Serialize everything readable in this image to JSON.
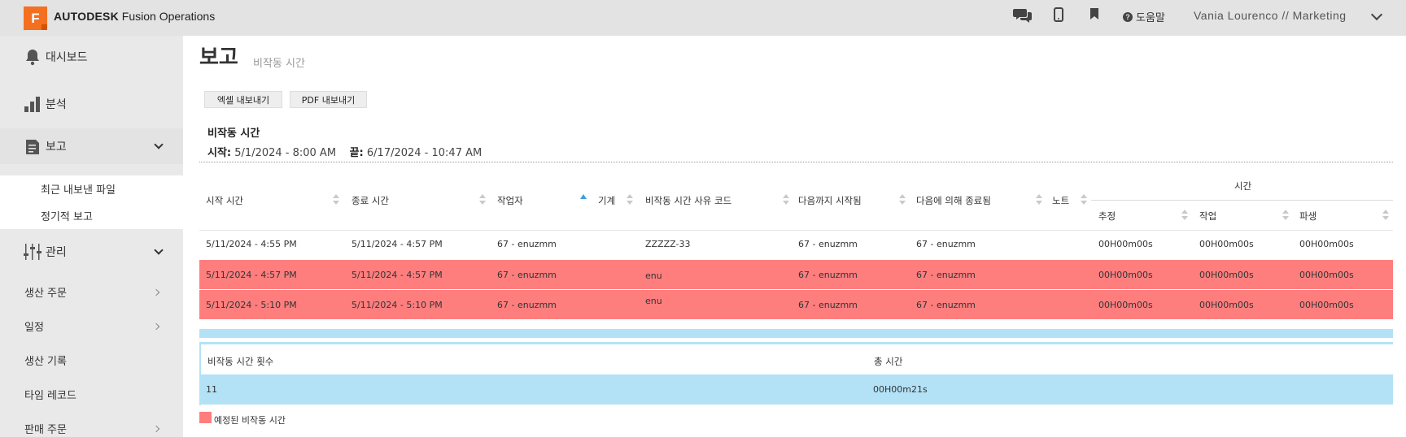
{
  "header": {
    "logo_letter": "F",
    "brand_bold": "AUTODESK",
    "brand_product": "Fusion Operations",
    "help_label": "도움말",
    "user": "Vania Lourenco // Marketing",
    "icons": [
      "chat-icon",
      "mobile-icon",
      "bookmark-icon",
      "help-icon",
      "chevron-down-icon"
    ]
  },
  "sidebar": {
    "dashboard": "대시보드",
    "analytics": "분석",
    "reports": "보고",
    "reports_sub": [
      "최근 내보낸 파일",
      "정기적 보고"
    ],
    "management": "관리",
    "management_sub": [
      "생산 주문",
      "일정",
      "생산 기록",
      "타임 레코드",
      "판매 주문"
    ]
  },
  "page": {
    "title": "보고",
    "subtitle": "비작동 시간",
    "export_excel": "엑셀 내보내기",
    "export_pdf": "PDF 내보내기",
    "report_title": "비작동 시간",
    "start_label": "시작:",
    "start_value": "5/1/2024 - 8:00 AM",
    "end_label": "끝:",
    "end_value": "6/17/2024 - 10:47 AM"
  },
  "table": {
    "headers": {
      "start": "시작 시간",
      "end": "종료 시간",
      "worker": "작업자",
      "machine": "기계",
      "reason": "비작동 시간 사유 코드",
      "started_by": "다음까지 시작됨",
      "ended_by": "다음에 의해 종료됨",
      "note": "노트",
      "time": "시간",
      "estimate": "추정",
      "work": "작업",
      "derived": "파생"
    },
    "rows": [
      {
        "start": "5/11/2024 - 4:55 PM",
        "end": "5/11/2024 - 4:57 PM",
        "worker": "67 - enuzmm",
        "machine": "",
        "reason": "ZZZZZ-33",
        "started_by": "67 - enuzmm",
        "ended_by": "67 - enuzmm",
        "note": "",
        "estimate": "00H00m00s",
        "work": "00H00m00s",
        "derived": "00H00m00s",
        "planned": false
      },
      {
        "start": "5/11/2024 - 4:57 PM",
        "end": "5/11/2024 - 4:57 PM",
        "worker": "67 - enuzmm",
        "machine": "",
        "reason": "enu",
        "started_by": "67 - enuzmm",
        "ended_by": "67 - enuzmm",
        "note": "",
        "estimate": "00H00m00s",
        "work": "00H00m00s",
        "derived": "00H00m00s",
        "planned": true
      },
      {
        "start": "5/11/2024 - 5:10 PM",
        "end": "5/11/2024 - 5:10 PM",
        "worker": "67 - enuzmm",
        "machine": "",
        "reason": "enu",
        "started_by": "67 - enuzmm",
        "ended_by": "67 - enuzmm",
        "note": "",
        "estimate": "00H00m00s",
        "work": "00H00m00s",
        "derived": "00H00m00s",
        "planned": true
      }
    ]
  },
  "summary": {
    "count_label": "비작동 시간 횟수",
    "total_label": "총 시간",
    "count_value": "11",
    "total_value": "00H00m21s"
  },
  "legend": {
    "planned_label": "예정된 비작동 시간",
    "planned_color": "#fe7e7e"
  },
  "colors": {
    "accent": "#f37021",
    "summary_blue": "#b3e2f7",
    "sort_active": "#3aa0d8"
  }
}
